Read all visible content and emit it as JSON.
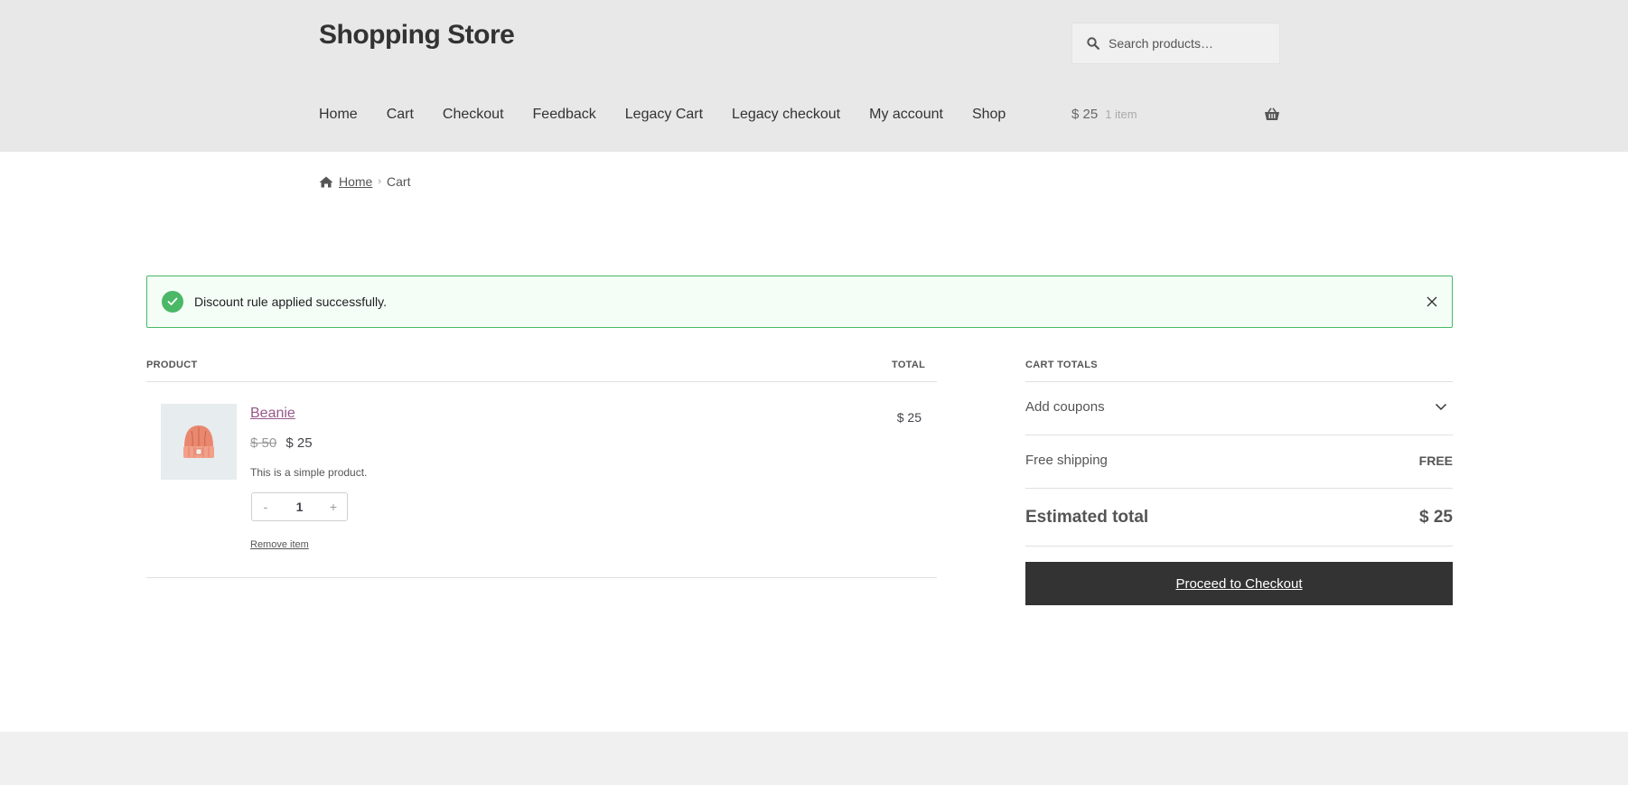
{
  "header": {
    "site_title": "Shopping Store",
    "search_placeholder": "Search products…",
    "nav": [
      "Home",
      "Cart",
      "Checkout",
      "Feedback",
      "Legacy Cart",
      "Legacy checkout",
      "My account",
      "Shop"
    ],
    "mini_cart": {
      "amount": "$ 25",
      "count": "1 item"
    }
  },
  "breadcrumb": {
    "home": "Home",
    "current": "Cart"
  },
  "notice": {
    "message": "Discount rule applied successfully."
  },
  "cart": {
    "col_product": "PRODUCT",
    "col_total": "TOTAL",
    "item": {
      "name": "Beanie",
      "regular_price": "$ 50",
      "sale_price": "$ 25",
      "description": "This is a simple product.",
      "quantity": "1",
      "qty_minus": "-",
      "qty_plus": "+",
      "remove_label": "Remove item",
      "line_total": "$ 25"
    }
  },
  "totals": {
    "heading": "CART TOTALS",
    "coupons_label": "Add coupons",
    "shipping_label": "Free shipping",
    "shipping_value": "FREE",
    "estimated_label": "Estimated total",
    "estimated_value": "$ 25",
    "checkout_label": "Proceed to Checkout"
  },
  "colors": {
    "header_bg": "#e8e8e8",
    "link_purple": "#96588a",
    "notice_green": "#4ab866",
    "button_dark": "#333333"
  }
}
